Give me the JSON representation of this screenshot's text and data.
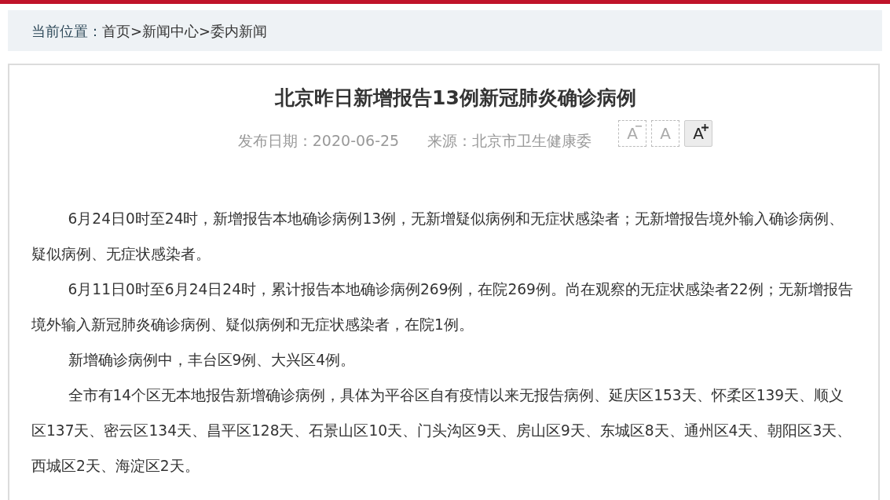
{
  "breadcrumb": {
    "label": "当前位置：",
    "items": [
      "首页",
      ">",
      "新闻中心",
      ">",
      "委内新闻"
    ]
  },
  "article": {
    "title": "北京昨日新增报告13例新冠肺炎确诊病例",
    "date": "发布日期：2020-06-25",
    "source": "来源：北京市卫生健康委",
    "font_buttons": [
      {
        "kind": "decrease",
        "label": "A",
        "disabled": true
      },
      {
        "kind": "reset",
        "label": "A",
        "disabled": true
      },
      {
        "kind": "increase",
        "label": "A",
        "disabled": false
      }
    ],
    "paragraphs": [
      "6月24日0时至24时，新增报告本地确诊病例13例，无新增疑似病例和无症状感染者；无新增报告境外输入确诊病例、疑似病例、无症状感染者。",
      "6月11日0时至6月24日24时，累计报告本地确诊病例269例，在院269例。尚在观察的无症状感染者22例；无新增报告境外输入新冠肺炎确诊病例、疑似病例和无症状感染者，在院1例。",
      "新增确诊病例中，丰台区9例、大兴区4例。",
      "全市有14个区无本地报告新增确诊病例，具体为平谷区自有疫情以来无报告病例、延庆区153天、怀柔区139天、顺义区137天、密云区134天、昌平区128天、石景山区10天、门头沟区9天、房山区9天、东城区8天、通州区4天、朝阳区3天、西城区2天、海淀区2天。"
    ]
  }
}
